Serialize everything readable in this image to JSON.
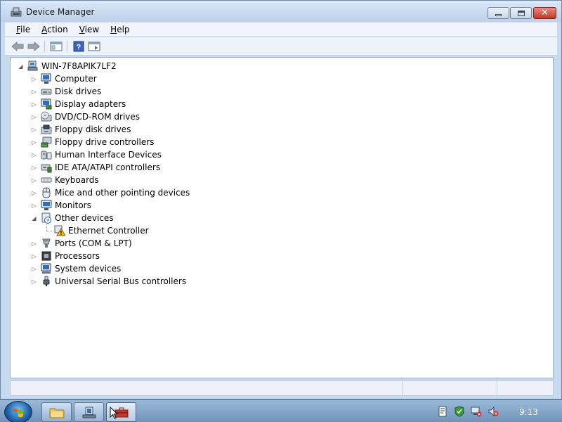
{
  "window": {
    "title": "Device Manager",
    "controls": {
      "minimize": "minimize-button",
      "maximize": "maximize-button",
      "close": "close-button"
    }
  },
  "menu": [
    {
      "label": "File",
      "accel": "F",
      "rest": "ile"
    },
    {
      "label": "Action",
      "accel": "A",
      "rest": "ction"
    },
    {
      "label": "View",
      "accel": "V",
      "rest": "iew"
    },
    {
      "label": "Help",
      "accel": "H",
      "rest": "elp"
    }
  ],
  "toolbar": {
    "buttons": [
      "back-arrow-icon",
      "forward-arrow-icon",
      "show-hide-console-tree-icon",
      "help-icon",
      "properties-pane-icon"
    ]
  },
  "tree": {
    "root": "WIN-7F8APIK7LF2",
    "categories": [
      {
        "label": "Computer",
        "icon": "computer-icon",
        "expanded": false
      },
      {
        "label": "Disk drives",
        "icon": "disk-drive-icon",
        "expanded": false
      },
      {
        "label": "Display adapters",
        "icon": "display-adapter-icon",
        "expanded": false
      },
      {
        "label": "DVD/CD-ROM drives",
        "icon": "dvd-drive-icon",
        "expanded": false
      },
      {
        "label": "Floppy disk drives",
        "icon": "floppy-disk-icon",
        "expanded": false
      },
      {
        "label": "Floppy drive controllers",
        "icon": "floppy-controller-icon",
        "expanded": false
      },
      {
        "label": "Human Interface Devices",
        "icon": "hid-icon",
        "expanded": false
      },
      {
        "label": "IDE ATA/ATAPI controllers",
        "icon": "ide-controller-icon",
        "expanded": false
      },
      {
        "label": "Keyboards",
        "icon": "keyboard-icon",
        "expanded": false
      },
      {
        "label": "Mice and other pointing devices",
        "icon": "mouse-icon",
        "expanded": false
      },
      {
        "label": "Monitors",
        "icon": "monitor-icon",
        "expanded": false
      },
      {
        "label": "Other devices",
        "icon": "unknown-device-icon",
        "expanded": true,
        "children": [
          {
            "label": "Ethernet Controller",
            "icon": "warning-device-icon"
          }
        ]
      },
      {
        "label": "Ports (COM & LPT)",
        "icon": "port-icon",
        "expanded": false
      },
      {
        "label": "Processors",
        "icon": "processor-icon",
        "expanded": false
      },
      {
        "label": "System devices",
        "icon": "system-device-icon",
        "expanded": false
      },
      {
        "label": "Universal Serial Bus controllers",
        "icon": "usb-icon",
        "expanded": false
      }
    ]
  },
  "taskbar": {
    "buttons": [
      "windows-explorer-icon",
      "server-manager-icon",
      "toolbox-icon"
    ],
    "tray_icons": [
      "action-center-icon",
      "security-icon",
      "network-icon",
      "volume-muted-icon"
    ],
    "clock": "9:13"
  },
  "colors": {
    "accent": "#1c5fa4",
    "close": "#c13a25",
    "warning": "#f2c200"
  }
}
